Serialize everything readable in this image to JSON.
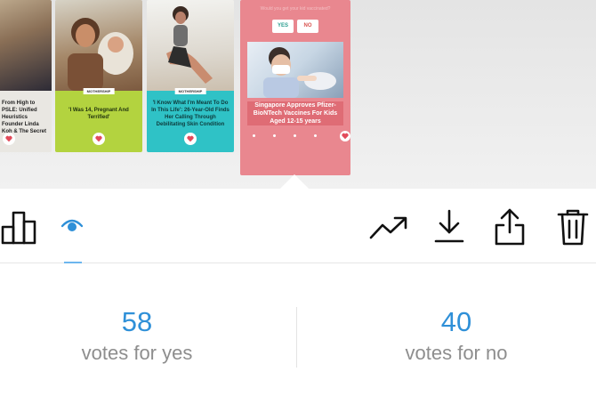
{
  "stories": [
    {
      "tag": "",
      "caption": "From High to PSLE: Unified Heuristics Founder Linda Koh & The Secret"
    },
    {
      "tag": "MOTHERSHIP",
      "caption": "'I Was 14, Pregnant And Terrified'"
    },
    {
      "tag": "MOTHERSHIP",
      "caption": "'I Know What I'm Meant To Do In This Life': 26-Year-Old Finds Her Calling Through Debilitating Skin Condition"
    },
    {
      "poll_title": "Would you get your kid vaccinated?",
      "poll_yes": "YES",
      "poll_no": "NO",
      "caption": "Singapore Approves Pfizer-BioNTech Vaccines For Kids Aged 12-15 years"
    }
  ],
  "toolbar": {
    "left": [
      {
        "icon": "bar-chart-icon"
      },
      {
        "icon": "eye-icon",
        "selected": true
      }
    ],
    "right": [
      {
        "icon": "trending-up-icon"
      },
      {
        "icon": "download-icon"
      },
      {
        "icon": "share-icon"
      },
      {
        "icon": "trash-icon"
      }
    ],
    "accent_color": "#2f90d8"
  },
  "votes": {
    "yes": {
      "count": "58",
      "label": "votes for yes"
    },
    "no": {
      "count": "40",
      "label": "votes for no"
    }
  }
}
